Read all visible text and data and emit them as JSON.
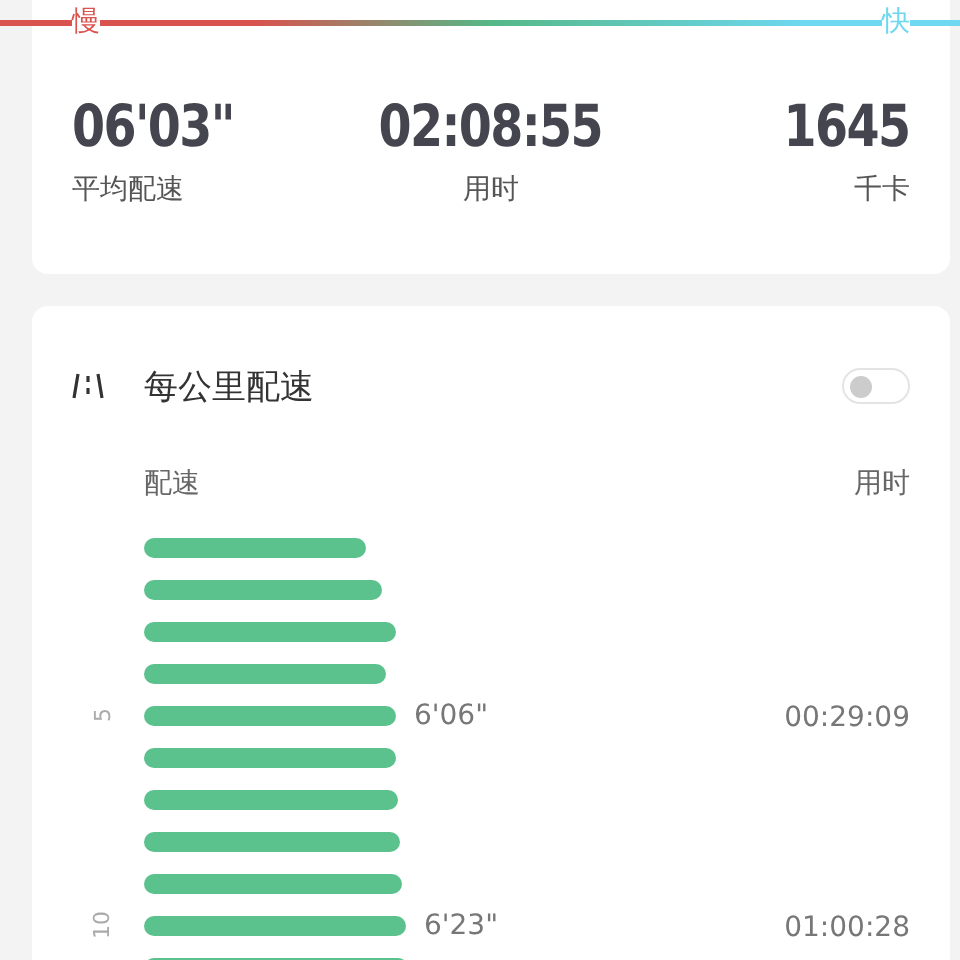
{
  "pace_scale": {
    "slow_label": "慢",
    "fast_label": "快"
  },
  "summary": [
    {
      "value": "06'03\"",
      "label": "平均配速"
    },
    {
      "value": "02:08:55",
      "label": "用时"
    },
    {
      "value": "1645",
      "label": "千卡"
    }
  ],
  "splits": {
    "title": "每公里配速",
    "toggle": {
      "on": false
    },
    "columns": [
      "配速",
      "用时"
    ],
    "rows": [
      {},
      {},
      {},
      {},
      {
        "km": "5",
        "pace": "6'06\"",
        "time": "00:29:09"
      },
      {},
      {},
      {},
      {},
      {
        "km": "10",
        "pace": "6'23\"",
        "time": "01:00:28"
      },
      {}
    ]
  }
}
